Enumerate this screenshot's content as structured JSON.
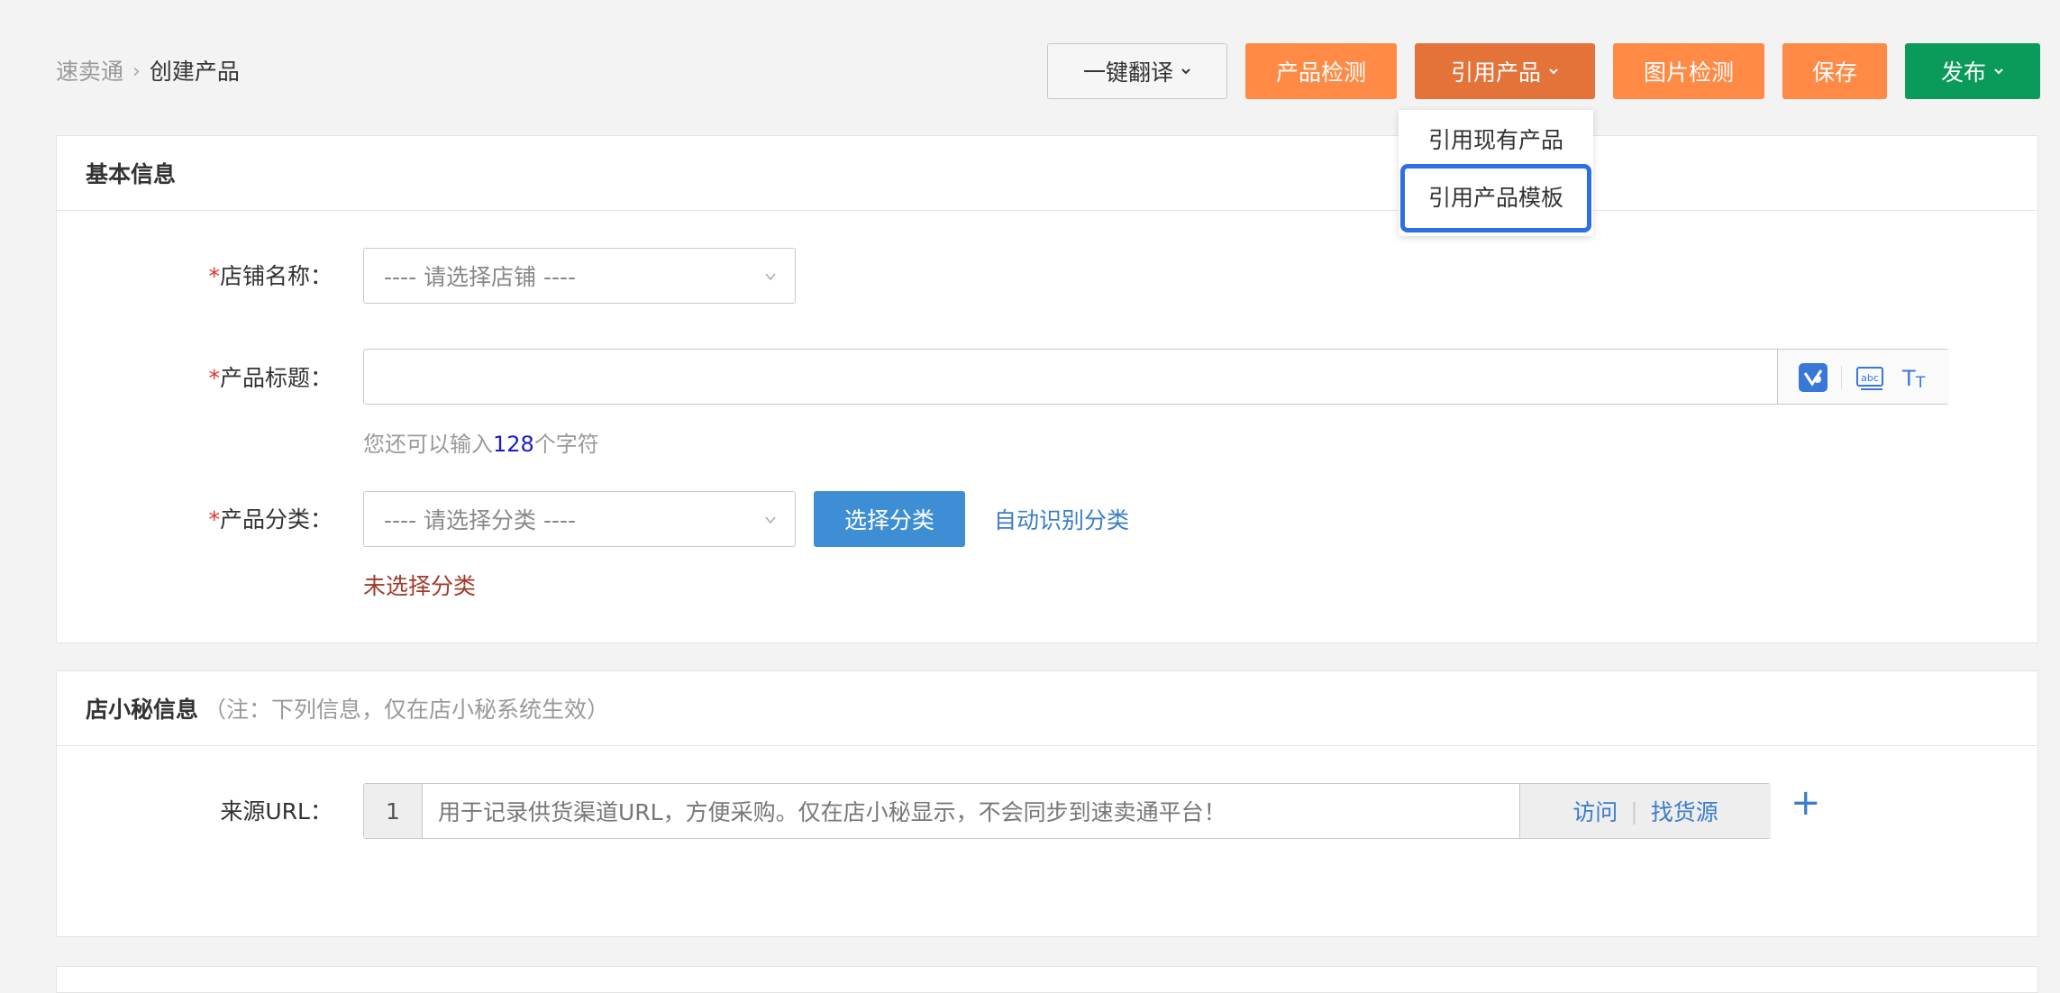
{
  "breadcrumb": {
    "parent": "速卖通",
    "current": "创建产品"
  },
  "toolbar": {
    "translate": "一键翻译",
    "product_check": "产品检测",
    "reference_product": "引用产品",
    "image_check": "图片检测",
    "save": "保存",
    "publish": "发布"
  },
  "reference_menu": {
    "existing": "引用现有产品",
    "template": "引用产品模板"
  },
  "basic": {
    "title": "基本信息",
    "store_label": "店铺名称",
    "store_placeholder": "---- 请选择店铺 ----",
    "product_title_label": "产品标题",
    "chars_prefix": "您还可以输入",
    "chars_count": "128",
    "chars_suffix": "个字符",
    "category_label": "产品分类",
    "category_placeholder": "---- 请选择分类 ----",
    "choose_category": "选择分类",
    "auto_detect": "自动识别分类",
    "category_error": "未选择分类"
  },
  "dxm": {
    "title": "店小秘信息",
    "note": "（注：下列信息，仅在店小秘系统生效）",
    "url_label": "来源URL",
    "url_index": "1",
    "url_placeholder": "用于记录供货渠道URL，方便采购。仅在店小秘显示，不会同步到速卖通平台！",
    "visit": "访问",
    "find_source": "找货源",
    "add": "+"
  },
  "colors": {
    "orange": "#ff8a45",
    "green": "#0a9a5a",
    "blue": "#3d8ed4",
    "highlight": "#2f6fe5"
  },
  "icons": [
    "chevron-down-icon",
    "translate-icon",
    "abc-check-icon",
    "text-case-icon",
    "plus-icon"
  ]
}
